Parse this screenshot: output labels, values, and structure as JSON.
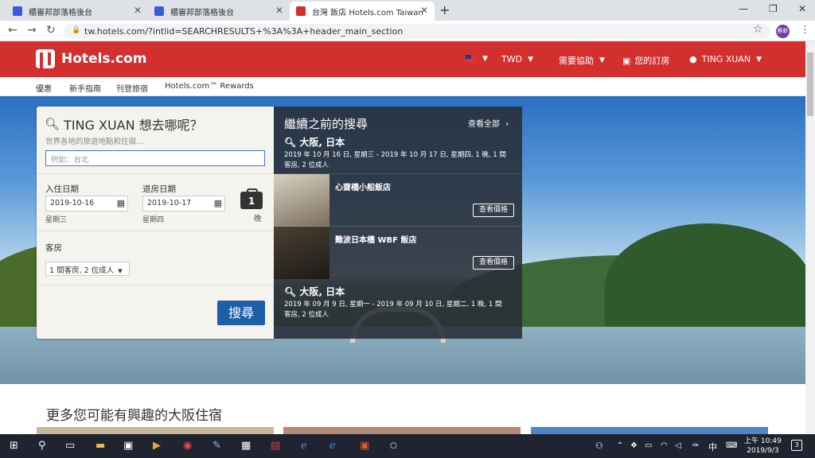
{
  "browser": {
    "tabs": [
      {
        "title": "櫃審邦部落格後台",
        "favicon_color": "#3a5bd9"
      },
      {
        "title": "櫃審邦部落格後台",
        "favicon_color": "#3a5bd9"
      },
      {
        "title": "台灣 飯店 Hotels.com Taiwan",
        "favicon_color": "#d32f2f"
      }
    ],
    "url": "tw.hotels.com/?intlid=SEARCHRESULTS+%3A%3A+header_main_section",
    "profile_label": "蔡軒"
  },
  "header": {
    "logo_text": "Hotels.com",
    "currency": "TWD",
    "help": "需要協助",
    "bookings": "您的訂房",
    "user": "TING XUAN",
    "brand_color": "#d32f2f"
  },
  "subnav": [
    "優惠",
    "新手指南",
    "刊登旅宿",
    "Hotels.com™ Rewards"
  ],
  "search": {
    "title": "TING XUAN 想去哪呢？",
    "subtitle": "世界各地的旅遊地點和住宿...",
    "placeholder": "例如：台北",
    "checkin_label": "入住日期",
    "checkin_value": "2019-10-16",
    "checkin_day": "星期三",
    "checkout_label": "退房日期",
    "checkout_value": "2019-10-17",
    "checkout_day": "星期四",
    "nights": "1",
    "nights_label": "晚",
    "rooms_label": "客房",
    "rooms_value": "1 間客房, 2 位成人",
    "button": "搜尋"
  },
  "recent": {
    "title": "繼續之前的搜尋",
    "view_all": "查看全部",
    "searches": [
      {
        "city": "大阪, 日本",
        "dates": "2019 年 10 月 16 日, 星期三 - 2019 年 10 月 17 日, 星期四, 1 晚, 1 間客房, 2 位成人"
      },
      {
        "city": "大阪, 日本",
        "dates": "2019 年 09 月 9 日, 星期一 - 2019 年 09 月 10 日, 星期二, 1 晚, 1 間客房, 2 位成人"
      }
    ],
    "hotels": [
      {
        "name": "心齋橋小船飯店",
        "button": "查看價格"
      },
      {
        "name": "難波日本橋 WBF 飯店",
        "button": "查看價格"
      }
    ]
  },
  "more_title": "更多您可能有興趣的大阪住宿",
  "taskbar": {
    "ime": "中",
    "time": "上午 10:49",
    "date": "2019/9/3",
    "notifications": "3"
  }
}
